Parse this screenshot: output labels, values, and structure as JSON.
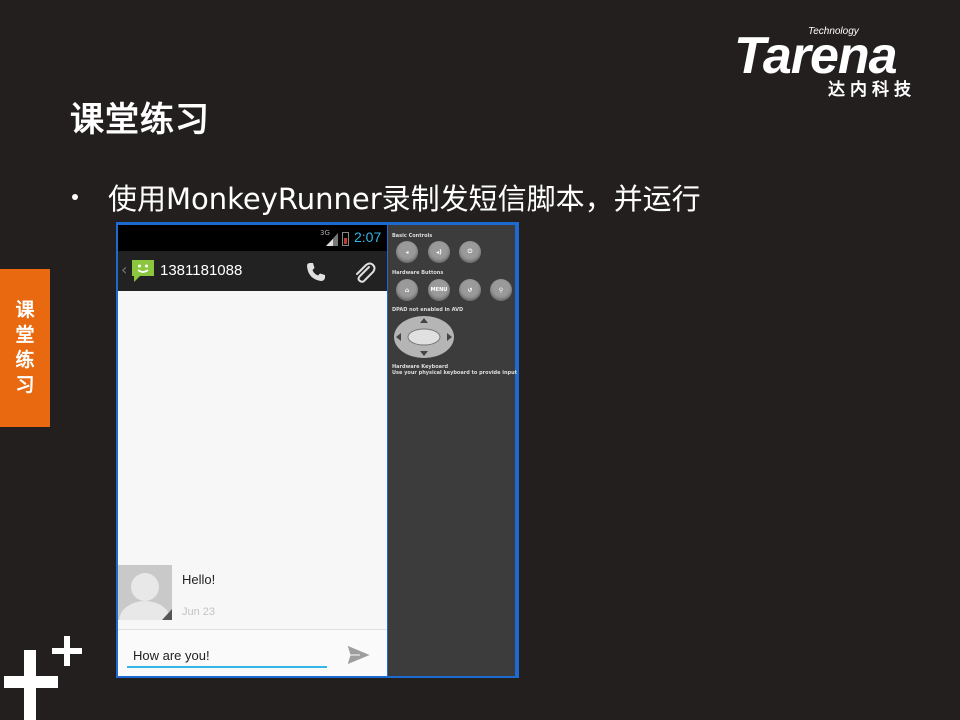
{
  "logo": {
    "technology": "Technology",
    "brand": "Tarena",
    "chinese": "达内科技"
  },
  "slide": {
    "title": "课堂练习",
    "bullet": "使用MonkeyRunner录制发短信脚本，并运行",
    "side_tab": [
      "课",
      "堂",
      "练",
      "习"
    ]
  },
  "emulator": {
    "statusbar": {
      "network": "3G",
      "time": "2:07"
    },
    "actionbar": {
      "number": "1381181088"
    },
    "message": {
      "text": "Hello!",
      "date": "Jun 23"
    },
    "compose": {
      "value": "How are you!"
    },
    "controls": {
      "basic_label": "Basic Controls",
      "hardware_label": "Hardware Buttons",
      "menu_label": "MENU",
      "dpad_label": "DPAD not enabled in AVD",
      "keyboard_label": "Hardware Keyboard",
      "keyboard_hint": "Use your physical keyboard to provide input"
    }
  },
  "colors": {
    "background": "#231f1f",
    "accent_orange": "#e8690f",
    "emulator_frame": "#1d6bd0",
    "holo_blue": "#33b5e5"
  }
}
